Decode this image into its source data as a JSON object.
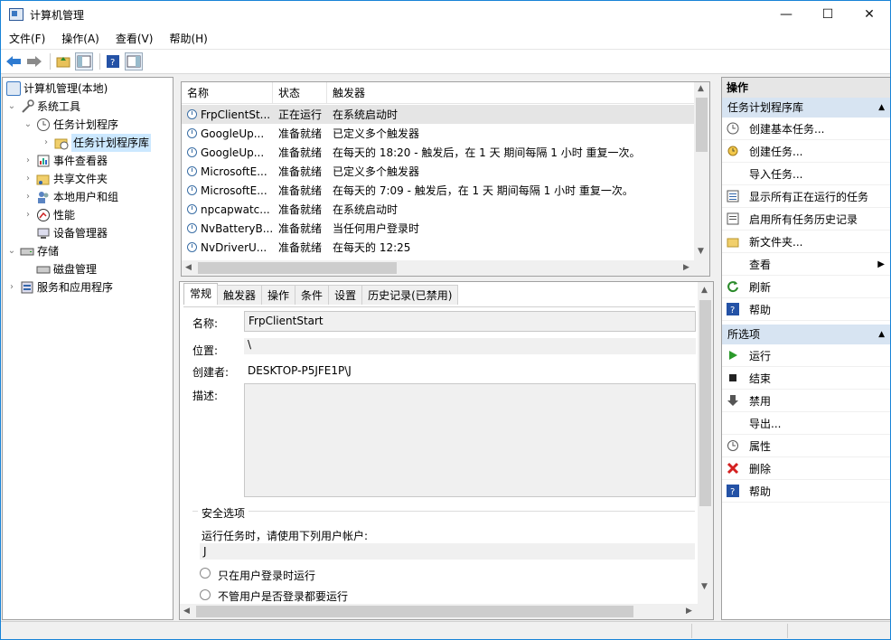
{
  "window": {
    "title": "计算机管理",
    "min": "—",
    "max": "☐",
    "close": "✕"
  },
  "menu": [
    "文件(F)",
    "操作(A)",
    "查看(V)",
    "帮助(H)"
  ],
  "tree": {
    "root": "计算机管理(本地)",
    "system_tools": "系统工具",
    "task_scheduler": "任务计划程序",
    "task_library": "任务计划程序库",
    "event_viewer": "事件查看器",
    "shared_folders": "共享文件夹",
    "local_users": "本地用户和组",
    "performance": "性能",
    "device_manager": "设备管理器",
    "storage": "存储",
    "disk_mgmt": "磁盘管理",
    "services_apps": "服务和应用程序"
  },
  "list": {
    "headers": [
      "名称",
      "状态",
      "触发器"
    ],
    "rows": [
      {
        "name": "FrpClientSt...",
        "status": "正在运行",
        "trigger": "在系统启动时"
      },
      {
        "name": "GoogleUp...",
        "status": "准备就绪",
        "trigger": "已定义多个触发器"
      },
      {
        "name": "GoogleUp...",
        "status": "准备就绪",
        "trigger": "在每天的 18:20 - 触发后，在 1 天 期间每隔 1 小时 重复一次。"
      },
      {
        "name": "MicrosoftE...",
        "status": "准备就绪",
        "trigger": "已定义多个触发器"
      },
      {
        "name": "MicrosoftE...",
        "status": "准备就绪",
        "trigger": "在每天的 7:09 - 触发后，在 1 天 期间每隔 1 小时 重复一次。"
      },
      {
        "name": "npcapwatc...",
        "status": "准备就绪",
        "trigger": "在系统启动时"
      },
      {
        "name": "NvBatteryB...",
        "status": "准备就绪",
        "trigger": "当任何用户登录时"
      },
      {
        "name": "NvDriverU...",
        "status": "准备就绪",
        "trigger": "在每天的 12:25"
      }
    ]
  },
  "detail": {
    "tabs": [
      "常规",
      "触发器",
      "操作",
      "条件",
      "设置",
      "历史记录(已禁用)"
    ],
    "name_label": "名称:",
    "name_value": "FrpClientStart",
    "location_label": "位置:",
    "location_value": "\\",
    "author_label": "创建者:",
    "author_value": "DESKTOP-P5JFE1P\\J",
    "desc_label": "描述:",
    "security_label": "安全选项",
    "run_as_label": "运行任务时，请使用下列用户帐户:",
    "run_as_value": "J",
    "radio1": "只在用户登录时运行",
    "radio2": "不管用户是否登录都要运行"
  },
  "actions": {
    "header": "操作",
    "section1": "任务计划程序库",
    "items1": [
      "创建基本任务...",
      "创建任务...",
      "导入任务...",
      "显示所有正在运行的任务",
      "启用所有任务历史记录",
      "新文件夹...",
      "查看",
      "刷新",
      "帮助"
    ],
    "section2": "所选项",
    "items2": [
      "运行",
      "结束",
      "禁用",
      "导出...",
      "属性",
      "删除",
      "帮助"
    ]
  }
}
